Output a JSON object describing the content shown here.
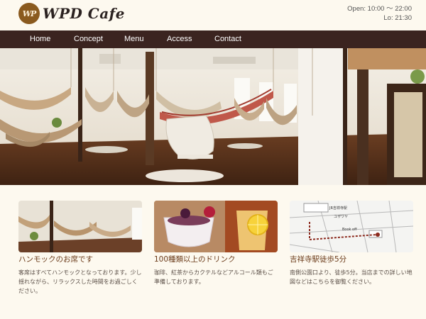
{
  "header": {
    "logo_mark": "WP",
    "logo_text": "WPD Cafe",
    "hours": "Open: 10:00 〜 22:00",
    "last_order": "Lo: 21:30"
  },
  "nav": {
    "items": [
      {
        "label": "Home"
      },
      {
        "label": "Concept"
      },
      {
        "label": "Menu"
      },
      {
        "label": "Access"
      },
      {
        "label": "Contact"
      }
    ]
  },
  "cards": [
    {
      "title": "ハンモックのお席です",
      "text": "客席はすべてハンモックとなっております。少し揺れながら、リラックスした時間をお過ごしください。"
    },
    {
      "title": "100種類以上のドリンク",
      "text": "珈琲、紅茶からカクテルなどアルコール類もご準備しております。"
    },
    {
      "title": "吉祥寺駅徒歩5分",
      "text": "南側公園口より、徒歩5分。当店までの詳しい地図などはこちらを御覧ください。"
    }
  ],
  "map": {
    "labels": [
      "JR吉祥寺駅",
      "ユザワヤ",
      "Book off"
    ]
  },
  "colors": {
    "background": "#fdf9ef",
    "nav": "#3b2420",
    "card_title": "#6b3b1a"
  }
}
